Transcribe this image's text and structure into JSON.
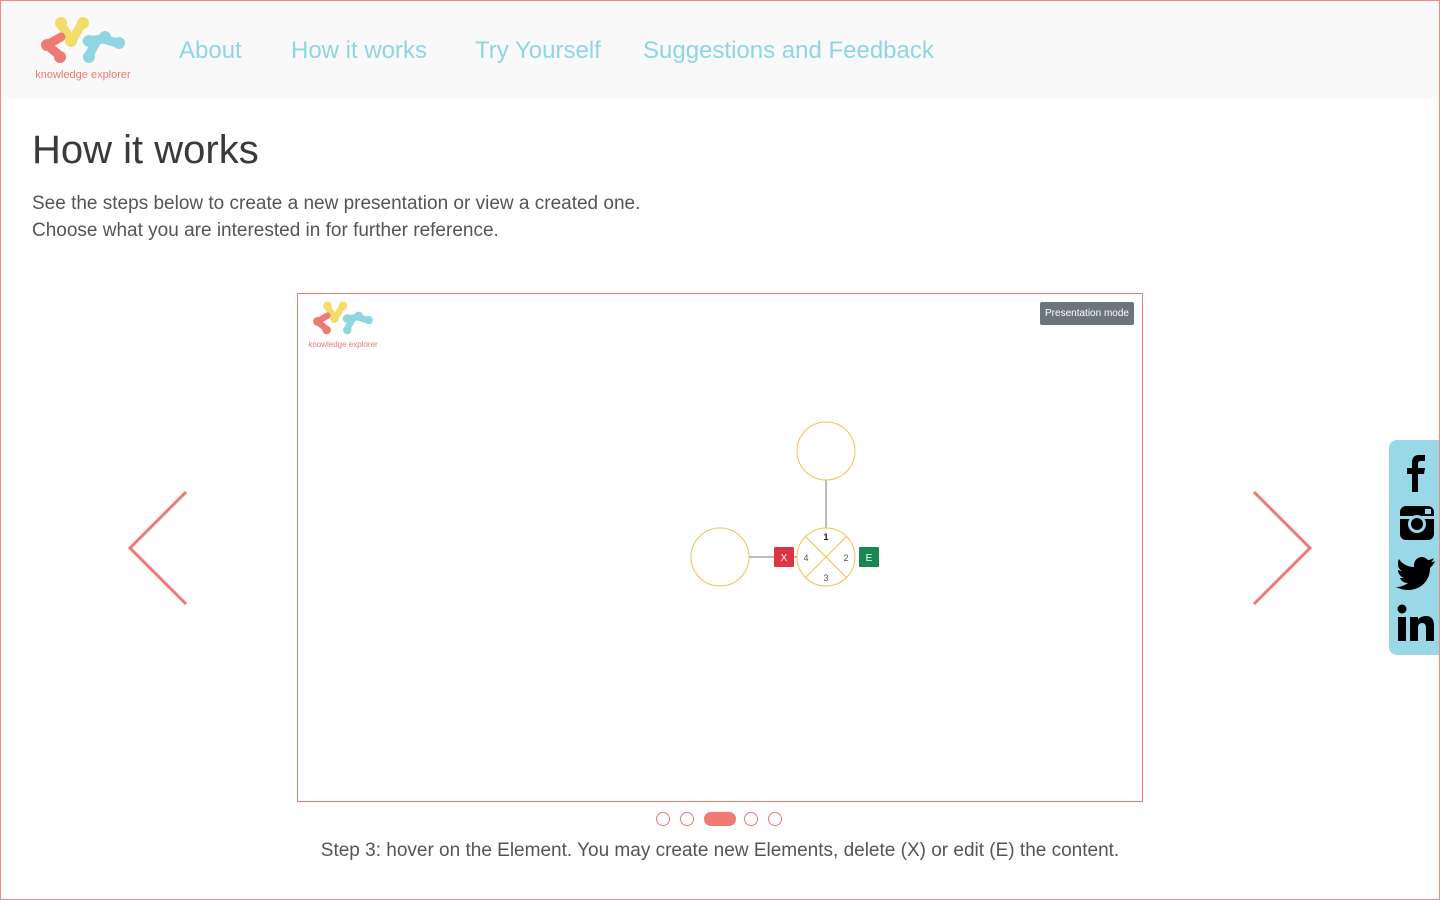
{
  "brand": {
    "logo_text": "knowledge explorer"
  },
  "nav": {
    "items": [
      {
        "label": "About"
      },
      {
        "label": "How it works"
      },
      {
        "label": "Try Yourself"
      },
      {
        "label": "Suggestions and Feedback"
      }
    ]
  },
  "main": {
    "title": "How it works",
    "intro_line1": "See the steps below to create a new presentation or view a created one.",
    "intro_line2": "Choose what you are interested in for further reference."
  },
  "carousel": {
    "prev_icon": "chevron-left-icon",
    "next_icon": "chevron-right-icon",
    "active_index": 3,
    "slide_count": 5,
    "caption": "Step 3: hover on the Element. You may create new Elements, delete (X) or edit (E) the content.",
    "slide": {
      "logo_text": "knowledge explorer",
      "presentation_button": "Presentation mode",
      "element": {
        "quadrant_top": "1",
        "quadrant_right": "2",
        "quadrant_bottom": "3",
        "quadrant_left": "4",
        "delete_label": "X",
        "edit_label": "E"
      }
    }
  },
  "social": {
    "items": [
      "facebook-icon",
      "instagram-icon",
      "twitter-icon",
      "linkedin-icon"
    ]
  },
  "colors": {
    "accent": "#ee7a73",
    "nav_text": "#8fd6e2",
    "node_stroke": "#f2c14e",
    "delete": "#dc3545",
    "edit": "#198754",
    "social_bg": "#99d8e6"
  }
}
